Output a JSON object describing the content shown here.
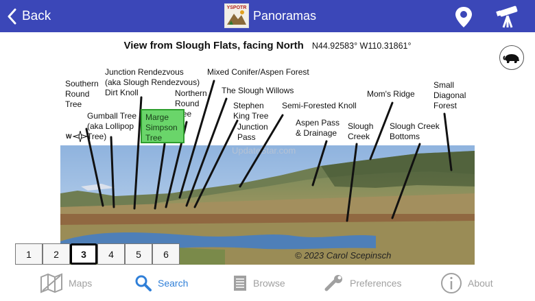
{
  "nav": {
    "back_label": "Back",
    "logo_text": "YSPOTR",
    "title": "Panoramas"
  },
  "view": {
    "title": "View from Slough Flats, facing North",
    "coords": "N44.92583° W110.31861°",
    "watermark": "UpdateStar.com",
    "credit": "© 2023 Carol Scepinsch",
    "compass_letter": "W"
  },
  "labels": {
    "southern_round_tree": [
      "Southern",
      "Round",
      "Tree"
    ],
    "junction_rendezvous": [
      "Junction Rendezvous",
      "(aka Slough Rendezvous)",
      "Dirt Knoll"
    ],
    "northern_round_tree": [
      "Northern",
      "Round",
      "Tree"
    ],
    "mixed_conifer": [
      "Mixed Conifer/Aspen Forest"
    ],
    "slough_willows": [
      "The Slough  Willows"
    ],
    "gumball_tree": [
      "Gumball Tree",
      "(aka Lollipop",
      "Tree)"
    ],
    "marge_simpson_tree": [
      "Marge",
      "Simpson",
      "Tree"
    ],
    "stephen_king_tree": [
      "Stephen",
      "King Tree"
    ],
    "junction_pass": [
      "Junction",
      "Pass"
    ],
    "semi_forested_knoll": [
      "Semi-Forested Knoll"
    ],
    "aspen_pass": [
      "Aspen Pass",
      "& Drainage"
    ],
    "moms_ridge": [
      "Mom's Ridge"
    ],
    "slough_creek": [
      "Slough",
      "Creek"
    ],
    "slough_creek_bottoms": [
      "Slough Creek",
      "Bottoms"
    ],
    "small_diagonal_forest": [
      "Small",
      "Diagonal",
      "Forest"
    ]
  },
  "pages": [
    "1",
    "2",
    "3",
    "4",
    "5",
    "6"
  ],
  "selected_page": "3",
  "tabs": {
    "maps": "Maps",
    "search": "Search",
    "browse": "Browse",
    "preferences": "Preferences",
    "about": "About"
  },
  "colors": {
    "nav_bar": "#3b47b8",
    "highlight": "#6ad56a",
    "active_tab": "#2f7fd8",
    "inactive_tab": "#a0a0a0"
  }
}
